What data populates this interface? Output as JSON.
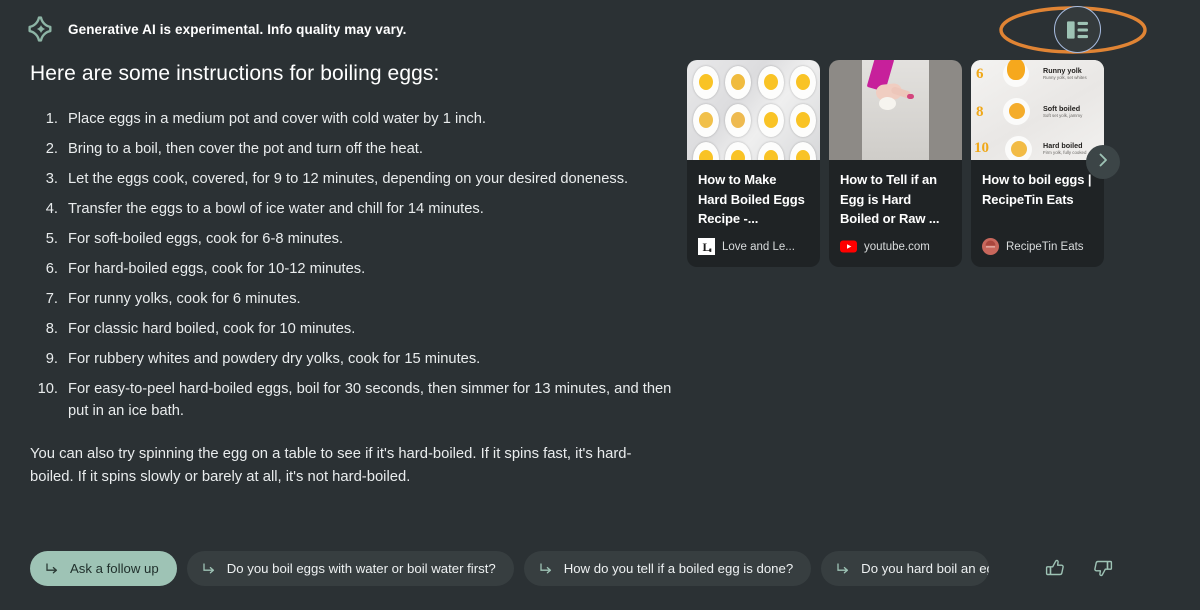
{
  "header": {
    "icon": "sparkle-icon",
    "disclaimer_bold": "Generative AI is experimental.",
    "disclaimer_rest": " Info quality may vary."
  },
  "view_toggle": {
    "icon": "layout-view-icon",
    "label": "Change view",
    "border_color": "#a8bce0",
    "icon_color": "#9ec3b5",
    "annotation_color": "#e08434"
  },
  "answer": {
    "title": "Here are some instructions for boiling eggs:",
    "steps": [
      {
        "num": "1.",
        "text": "Place eggs in a medium pot and cover with cold water by 1 inch."
      },
      {
        "num": "2.",
        "text": "Bring to a boil, then cover the pot and turn off the heat."
      },
      {
        "num": "3.",
        "text": "Let the eggs cook, covered, for 9 to 12 minutes, depending on your desired doneness."
      },
      {
        "num": "4.",
        "text": "Transfer the eggs to a bowl of ice water and chill for 14 minutes."
      },
      {
        "num": "5.",
        "text": "For soft-boiled eggs, cook for 6-8 minutes."
      },
      {
        "num": "6.",
        "text": "For hard-boiled eggs, cook for 10-12 minutes."
      },
      {
        "num": "7.",
        "text": "For runny yolks, cook for 6 minutes."
      },
      {
        "num": "8.",
        "text": "For classic hard boiled, cook for 10 minutes."
      },
      {
        "num": "9.",
        "text": "For rubbery whites and powdery dry yolks, cook for 15 minutes."
      },
      {
        "num": "10.",
        "text": "For easy-to-peel hard-boiled eggs, boil for 30 seconds, then simmer for 13 minutes, and then put in an ice bath."
      }
    ],
    "outro": "You can also try spinning the egg on a table to see if it's hard-boiled. If it spins fast, it's hard-boiled. If it spins slowly or barely at all, it's not hard-boiled."
  },
  "sources": {
    "next_button_label": "Next",
    "next_icon": "chevron-right-icon",
    "cards": [
      {
        "title": "How to Make Hard Boiled Eggs Recipe -...",
        "source": "Love and Le...",
        "favicon": "loveandlemons-favicon",
        "thumb": "halved-boiled-eggs-photo"
      },
      {
        "title": "How to Tell if an Egg is Hard Boiled or Raw ...",
        "source": "youtube.com",
        "favicon": "youtube-favicon",
        "thumb": "hand-spinning-egg-video"
      },
      {
        "title": "How to boil eggs | RecipeTin Eats",
        "source": "RecipeTin Eats",
        "favicon": "recipetineats-favicon",
        "thumb": "egg-doneness-infographic",
        "infographic": [
          {
            "minutes": "6",
            "label": "Runny yolk",
            "sub": "Runny yolk, set whites"
          },
          {
            "minutes": "8",
            "label": "Soft boiled",
            "sub": "Soft set yolk, jammy"
          },
          {
            "minutes": "10",
            "label": "Hard boiled",
            "sub": "Firm yolk, fully cooked"
          }
        ]
      }
    ]
  },
  "followups": {
    "chips": [
      {
        "label": "Ask a follow up",
        "style": "primary",
        "icon": "reply-arrow-icon"
      },
      {
        "label": "Do you boil eggs with water or boil water first?",
        "style": "secondary",
        "icon": "reply-arrow-icon"
      },
      {
        "label": "How do you tell if a boiled egg is done?",
        "style": "secondary",
        "icon": "reply-arrow-icon"
      },
      {
        "label": "Do you hard boil an egg",
        "style": "secondary",
        "icon": "reply-arrow-icon"
      }
    ],
    "thumbs_up_icon": "thumbs-up-icon",
    "thumbs_down_icon": "thumbs-down-icon"
  }
}
